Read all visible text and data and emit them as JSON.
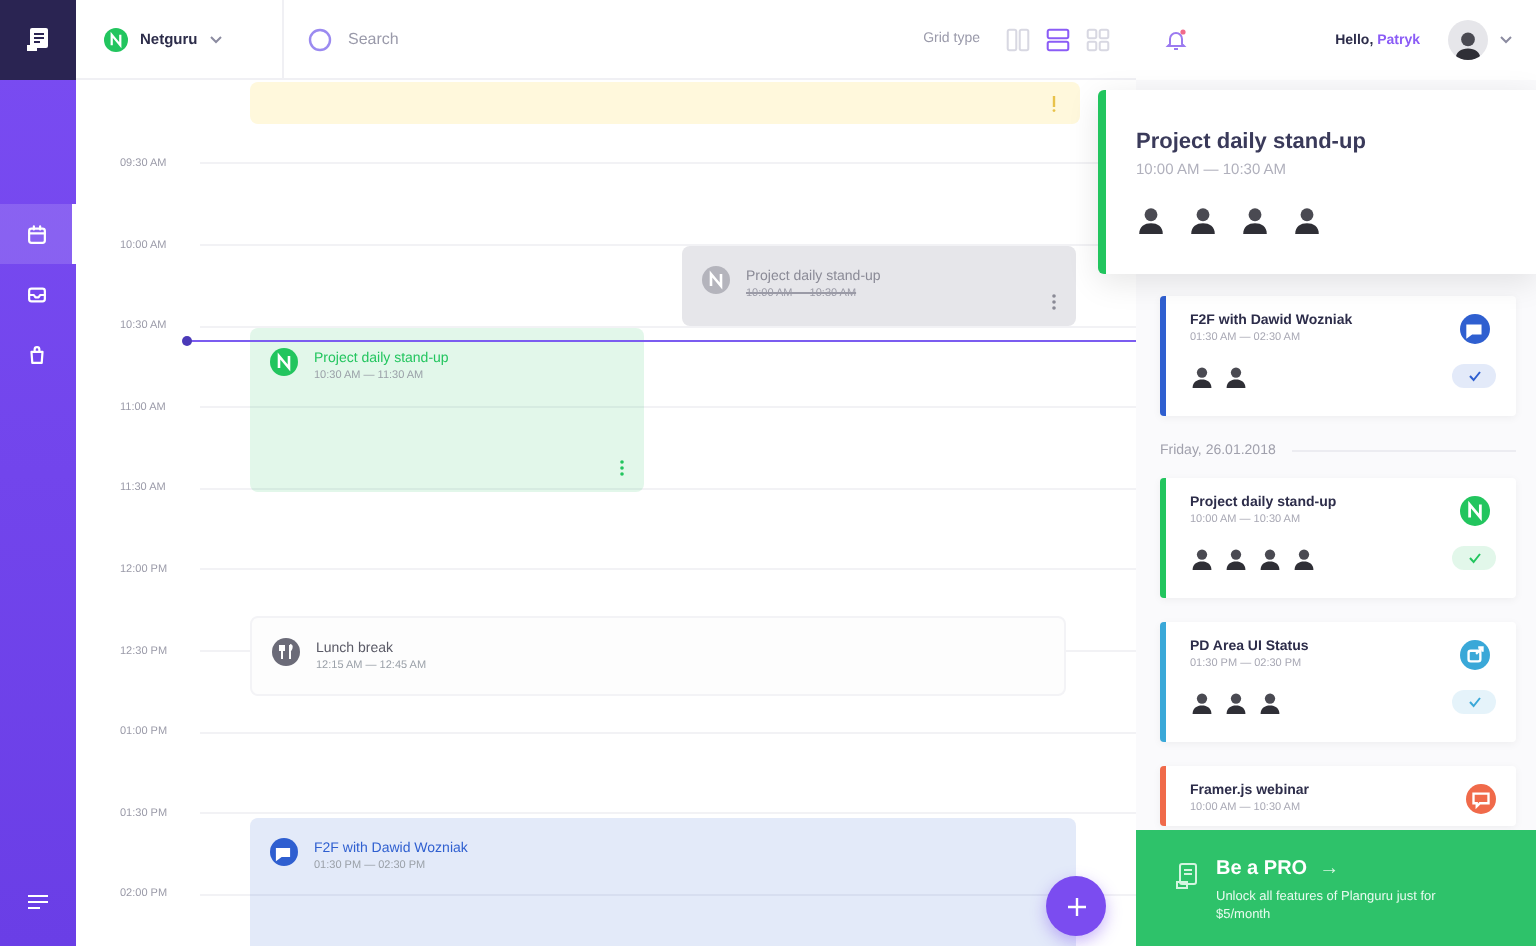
{
  "sidebar": {
    "items": [
      {
        "kind": "calendar",
        "selected": true
      },
      {
        "kind": "inbox",
        "selected": false
      },
      {
        "kind": "bag",
        "selected": false
      }
    ]
  },
  "header": {
    "workspace": "Netguru",
    "search": {
      "placeholder": "Search"
    },
    "grid_type": {
      "label": "Grid type",
      "options": [
        {
          "kind": "columns",
          "selected": false
        },
        {
          "kind": "rows",
          "selected": true
        },
        {
          "kind": "tiles",
          "selected": false
        }
      ]
    }
  },
  "timeline": {
    "times": [
      "09:30 AM",
      "10:00 AM",
      "10:30 AM",
      "11:00 AM",
      "11:30 AM",
      "12:00 PM",
      "12:30 PM",
      "01:00 PM",
      "01:30 PM",
      "02:00 PM"
    ],
    "events": [
      {
        "kind": "warning",
        "color": "#fff8dc"
      },
      {
        "kind": "meeting",
        "title": "Project daily stand-up",
        "time": "10:00 AM — 10:30 AM",
        "color": "#e6e6ea",
        "done": true
      },
      {
        "kind": "meeting",
        "title": "Project daily stand-up",
        "time": "10:30 AM — 11:30 AM",
        "color": "#22c55e",
        "done": false
      },
      {
        "kind": "lunch",
        "title": "Lunch break",
        "time": "12:15 AM — 12:45 AM",
        "color": "#6b6b78",
        "done": false
      },
      {
        "kind": "chat",
        "title": "F2F with Dawid Wozniak",
        "time": "01:30 PM — 02:30 PM",
        "color": "#2f5fd0",
        "done": false
      }
    ]
  },
  "user": {
    "greeting": "Hello,",
    "name": "Patryk"
  },
  "popup": {
    "title": "Project daily stand-up",
    "time": "10:00 AM — 10:30 AM",
    "attendees": [
      {
        "kind": "avatar"
      },
      {
        "kind": "avatar"
      },
      {
        "kind": "avatar"
      },
      {
        "kind": "avatar"
      }
    ]
  },
  "agenda": [
    {
      "kind": "chat",
      "title": "F2F with Dawid Wozniak",
      "time": "01:30 AM — 02:30 AM",
      "color": "#2f5fd0",
      "confirmed": true,
      "attendees": [
        {
          "kind": "avatar"
        },
        {
          "kind": "avatar"
        }
      ]
    },
    {
      "kind": "date",
      "label": "Friday, 26.01.2018"
    },
    {
      "kind": "logo",
      "title": "Project daily stand-up",
      "time": "10:00 AM — 10:30 AM",
      "color": "#22c55e",
      "confirmed": true,
      "attendees": [
        {
          "kind": "avatar"
        },
        {
          "kind": "avatar"
        },
        {
          "kind": "avatar"
        },
        {
          "kind": "avatar"
        }
      ]
    },
    {
      "kind": "share",
      "title": "PD Area UI Status",
      "time": "01:30 PM — 02:30 PM",
      "color": "#3aa8d8",
      "confirmed": true,
      "attendees": [
        {
          "kind": "avatar"
        },
        {
          "kind": "avatar"
        },
        {
          "kind": "avatar"
        }
      ]
    },
    {
      "kind": "screen",
      "title": "Framer.js webinar",
      "time": "10:00 AM — 10:30 AM",
      "color": "#f06a4a"
    }
  ],
  "promo": {
    "title": "Be a PRO",
    "arrow": "→",
    "text": "Unlock all features of Planguru just for $5/month"
  }
}
